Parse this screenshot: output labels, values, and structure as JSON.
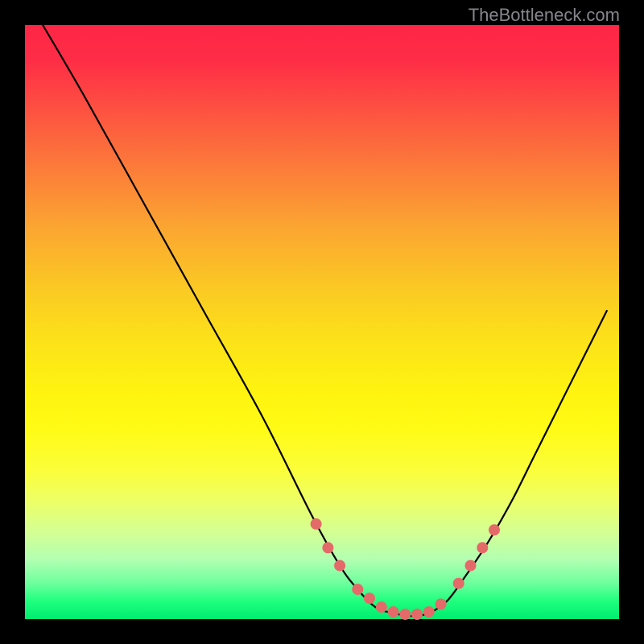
{
  "watermark": "TheBottleneck.com",
  "chart_data": {
    "type": "line",
    "title": "",
    "xlabel": "",
    "ylabel": "",
    "xlim": [
      0,
      100
    ],
    "ylim": [
      0,
      100
    ],
    "grid": false,
    "series": [
      {
        "name": "curve",
        "x": [
          3,
          10,
          20,
          30,
          40,
          48,
          53,
          56,
          59,
          62,
          65,
          68,
          71,
          74,
          78,
          82,
          86,
          90,
          94,
          98
        ],
        "values": [
          100,
          88,
          70,
          52,
          34,
          18,
          9,
          5,
          2,
          1,
          0.5,
          1,
          3,
          7,
          13,
          20,
          28,
          36,
          44,
          52
        ]
      }
    ],
    "markers": {
      "name": "dots",
      "color": "#e46a6a",
      "x": [
        49,
        51,
        53,
        56,
        58,
        60,
        62,
        64,
        66,
        68,
        70,
        73,
        75,
        77,
        79
      ],
      "values": [
        16,
        12,
        9,
        5,
        3.5,
        2,
        1.2,
        0.8,
        0.8,
        1.2,
        2.5,
        6,
        9,
        12,
        15
      ]
    }
  }
}
